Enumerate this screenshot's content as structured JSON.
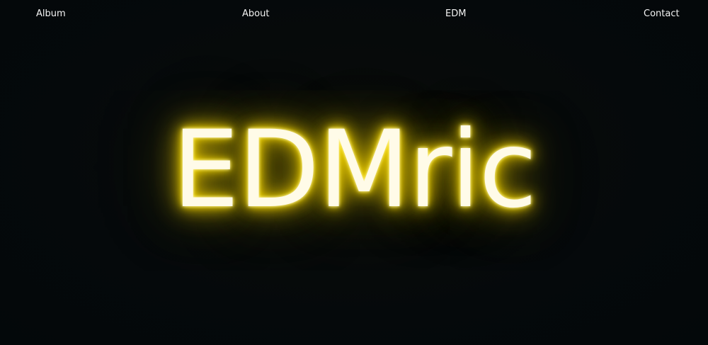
{
  "nav": {
    "items": [
      {
        "label": "Album"
      },
      {
        "label": "About"
      },
      {
        "label": "EDM"
      },
      {
        "label": "Contact"
      }
    ]
  },
  "hero": {
    "title": "EDMric",
    "glow_color": "#ffe600",
    "text_color": "#fffbe8"
  },
  "page": {
    "background_color": "#05090b"
  }
}
